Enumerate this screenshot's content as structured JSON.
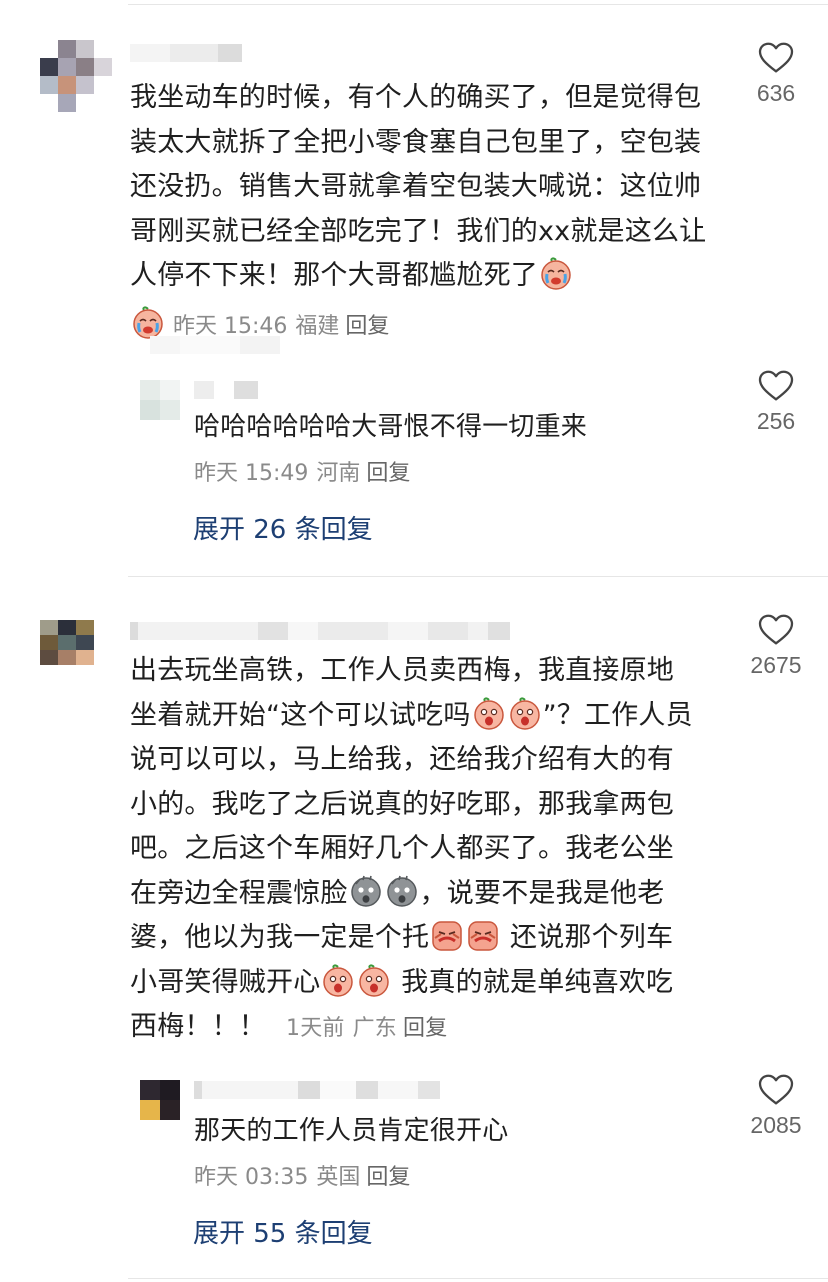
{
  "comments": [
    {
      "text": "我坐动车的时候，有个人的确买了，但是觉得包装太大就拆了全把小零食塞自己包里了，空包装还没扔。销售大哥就拿着空包装大喊说：这位帅哥刚买就已经全部吃完了！我们的xx就是这么让人停不下来！那个大哥都尴尬死了",
      "time": "昨天 15:46",
      "location": "福建",
      "reply_label": "回复",
      "likes": "636",
      "reply": {
        "text": "哈哈哈哈哈哈大哥恨不得一切重来",
        "time": "昨天 15:49",
        "location": "河南",
        "reply_label": "回复",
        "likes": "256"
      },
      "expand_label": "展开 26 条回复"
    },
    {
      "text_lines": [
        "出去玩坐高铁，工作人员卖西梅，我直接原地",
        "坐着就开始“这个可以试吃吗",
        "”？工作人员",
        "说可以可以，马上给我，还给我介绍有大的有",
        "小的。我吃了之后说真的好吃耶，那我拿两包",
        "吧。之后这个车厢好几个人都买了。我老公坐",
        "在旁边全程震惊脸",
        "，说要不是我是他老",
        "婆，他以为我一定是个托",
        "还说那个列车",
        "小哥笑得贼开心",
        "我真的就是单纯喜欢吃",
        "西梅！！！"
      ],
      "time": "1天前",
      "location": "广东",
      "reply_label": "回复",
      "likes": "2675",
      "reply": {
        "text": "那天的工作人员肯定很开心",
        "time": "昨天 03:35",
        "location": "英国",
        "reply_label": "回复",
        "likes": "2085"
      },
      "expand_label": "展开 55 条回复"
    }
  ],
  "icons": {
    "like": "heart-outline-icon",
    "emoji_cry": "crying-emoji-icon",
    "emoji_wow": "surprised-emoji-icon",
    "emoji_shock": "shocked-gray-emoji-icon",
    "emoji_cover": "facepalm-emoji-icon"
  },
  "colors": {
    "link": "#1d3f73",
    "meta": "#8a8a8a",
    "divider": "#e6e6e6"
  }
}
